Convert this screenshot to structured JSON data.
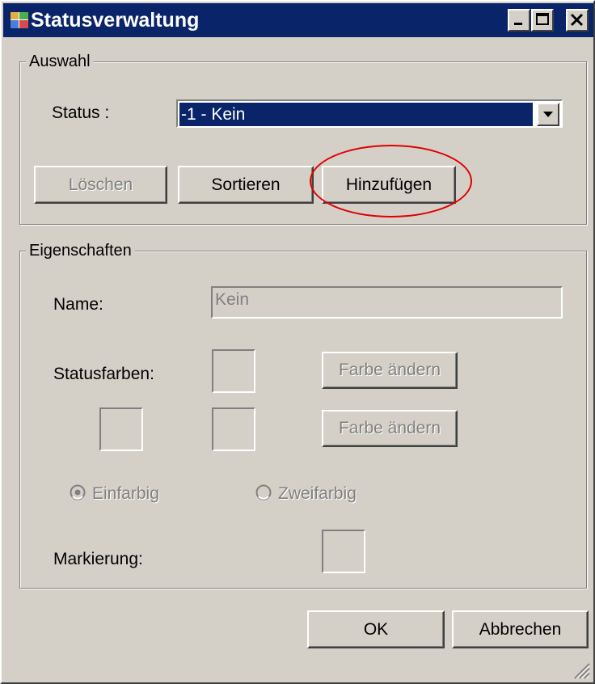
{
  "window": {
    "title": "Statusverwaltung",
    "icon": "app-icon",
    "controls": {
      "minimize": "minimize-icon",
      "maximize": "maximize-icon",
      "close": "close-icon"
    }
  },
  "auswahl": {
    "legend": "Auswahl",
    "status_label": "Status :",
    "status_value": "-1 - Kein",
    "buttons": {
      "delete": "Löschen",
      "sort": "Sortieren",
      "add": "Hinzufügen"
    }
  },
  "eigenschaften": {
    "legend": "Eigenschaften",
    "name_label": "Name:",
    "name_value": "Kein",
    "statusfarben_label": "Statusfarben:",
    "change_color_1": "Farbe ändern",
    "change_color_2": "Farbe ändern",
    "radio_einfarbig": "Einfarbig",
    "radio_zweifarbig": "Zweifarbig",
    "radio_selected": "Einfarbig",
    "markierung_label": "Markierung:"
  },
  "footer": {
    "ok": "OK",
    "cancel": "Abbrechen"
  },
  "colors": {
    "titlebar": "#0a246a",
    "face": "#d4d0c8",
    "annotation": "#e00000"
  }
}
